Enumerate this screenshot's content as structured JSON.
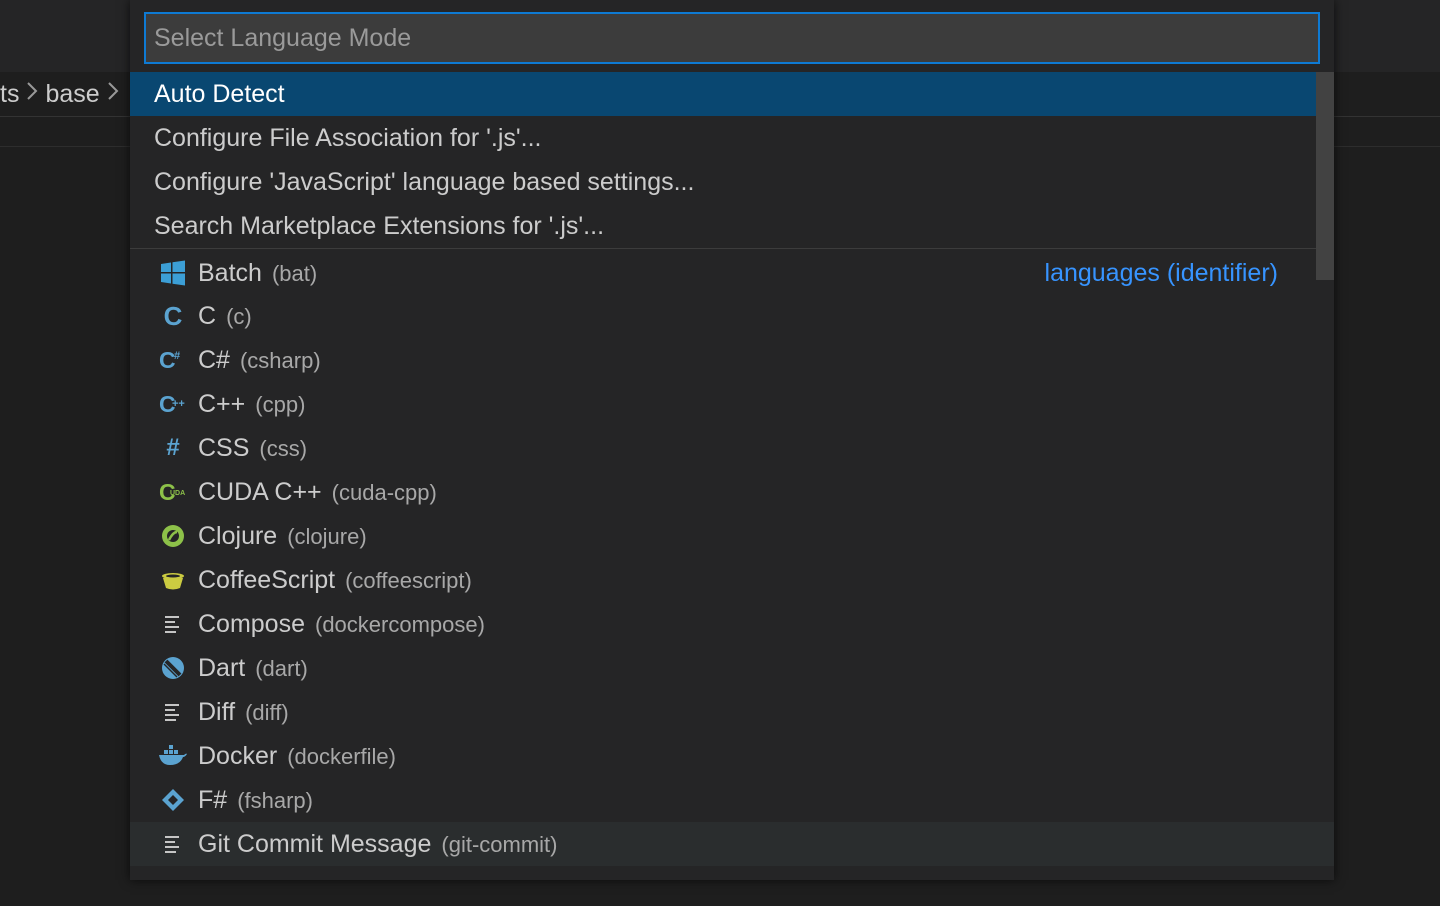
{
  "breadcrumb": {
    "seg1": "ts",
    "seg2": "base"
  },
  "quickpick": {
    "placeholder": "Select Language Mode",
    "commands": [
      {
        "label": "Auto Detect",
        "selected": true
      },
      {
        "label": "Configure File Association for '.js'..."
      },
      {
        "label": "Configure 'JavaScript' language based settings..."
      },
      {
        "label": "Search Marketplace Extensions for '.js'..."
      }
    ],
    "group_label": "languages (identifier)",
    "languages": [
      {
        "name": "Batch",
        "id": "(bat)",
        "icon": "windows-icon"
      },
      {
        "name": "C",
        "id": "(c)",
        "icon": "c-icon"
      },
      {
        "name": "C#",
        "id": "(csharp)",
        "icon": "csharp-icon"
      },
      {
        "name": "C++",
        "id": "(cpp)",
        "icon": "cpp-icon"
      },
      {
        "name": "CSS",
        "id": "(css)",
        "icon": "css-hash-icon"
      },
      {
        "name": "CUDA C++",
        "id": "(cuda-cpp)",
        "icon": "cuda-icon"
      },
      {
        "name": "Clojure",
        "id": "(clojure)",
        "icon": "clojure-icon"
      },
      {
        "name": "CoffeeScript",
        "id": "(coffeescript)",
        "icon": "coffee-cup-icon"
      },
      {
        "name": "Compose",
        "id": "(dockercompose)",
        "icon": "lines-icon"
      },
      {
        "name": "Dart",
        "id": "(dart)",
        "icon": "dart-icon"
      },
      {
        "name": "Diff",
        "id": "(diff)",
        "icon": "lines-icon"
      },
      {
        "name": "Docker",
        "id": "(dockerfile)",
        "icon": "docker-whale-icon"
      },
      {
        "name": "F#",
        "id": "(fsharp)",
        "icon": "fsharp-icon"
      },
      {
        "name": "Git Commit Message",
        "id": "(git-commit)",
        "icon": "lines-icon",
        "hover": true
      }
    ]
  },
  "colors": {
    "selection": "#094771",
    "focus_border": "#0e7ad3",
    "group_label": "#3794ff",
    "background": "#252526"
  }
}
